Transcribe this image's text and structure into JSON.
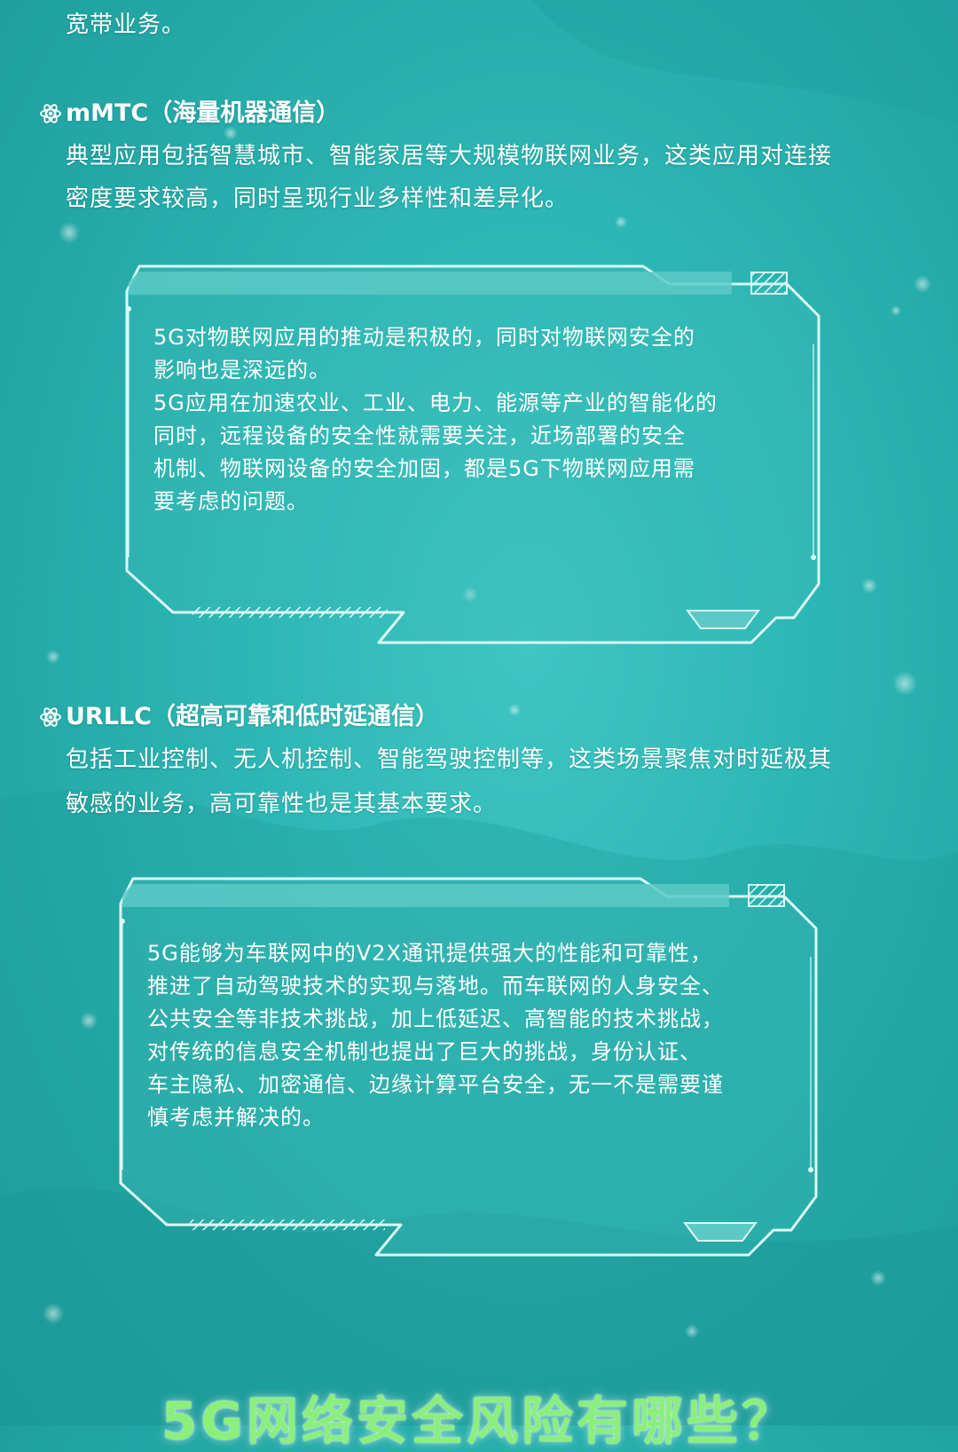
{
  "colors": {
    "background": "#2db7b4",
    "text": "#ffffff",
    "frame_stroke": "#d9fbf9",
    "frame_fill": "#5cc9c6",
    "title_green": "#8af07a"
  },
  "icons": {
    "heading_bullet": "atom-icon"
  },
  "intro_tail": "宽带业务。",
  "mmtc": {
    "heading": "mMTC（海量机器通信）",
    "lines": [
      "典型应用包括智慧城市、智能家居等大规模物联网业务，这类应用对连接",
      "密度要求较高，同时呈现行业多样性和差异化。"
    ],
    "box_lines": [
      "5G对物联网应用的推动是积极的，同时对物联网安全的",
      "影响也是深远的。",
      "5G应用在加速农业、工业、电力、能源等产业的智能化的",
      "同时，远程设备的安全性就需要关注，近场部署的安全",
      "机制、物联网设备的安全加固，都是5G下物联网应用需",
      "要考虑的问题。"
    ]
  },
  "urllc": {
    "heading": "URLLC（超高可靠和低时延通信）",
    "lines": [
      "包括工业控制、无人机控制、智能驾驶控制等，这类场景聚焦对时延极其",
      "敏感的业务，高可靠性也是其基本要求。"
    ],
    "box_lines": [
      "5G能够为车联网中的V2X通讯提供强大的性能和可靠性，",
      "推进了自动驾驶技术的实现与落地。而车联网的人身安全、",
      "公共安全等非技术挑战，加上低延迟、高智能的技术挑战，",
      "对传统的信息安全机制也提出了巨大的挑战，身份认证、",
      "车主隐私、加密通信、边缘计算平台安全，无一不是需要谨",
      "慎考虑并解决的。"
    ]
  },
  "section_title": "5G网络安全风险有哪些？"
}
